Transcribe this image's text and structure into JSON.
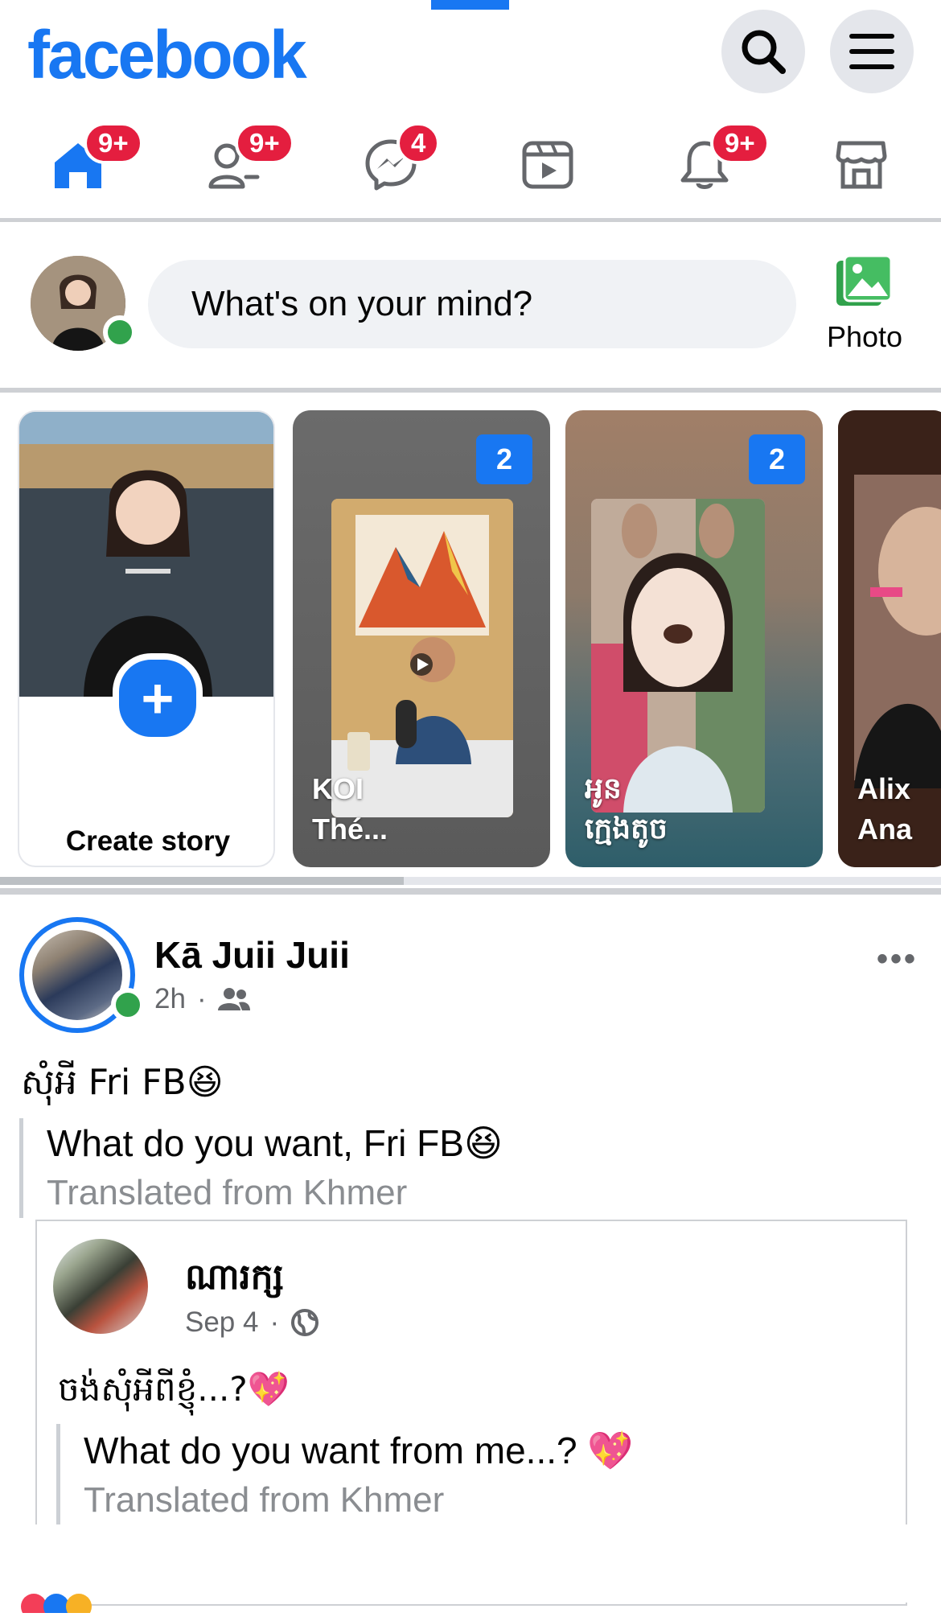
{
  "header": {
    "logo": "facebook",
    "search_icon": "search-icon",
    "menu_icon": "menu-icon"
  },
  "nav": [
    {
      "name": "home",
      "icon": "home-icon",
      "badge": "9+"
    },
    {
      "name": "friends",
      "icon": "friends-icon",
      "badge": "9+"
    },
    {
      "name": "messenger",
      "icon": "messenger-icon",
      "badge": "4"
    },
    {
      "name": "watch",
      "icon": "video-icon",
      "badge": ""
    },
    {
      "name": "notifications",
      "icon": "bell-icon",
      "badge": "9+"
    },
    {
      "name": "marketplace",
      "icon": "store-icon",
      "badge": ""
    }
  ],
  "composer": {
    "placeholder": "What's on your mind?",
    "photo_label": "Photo"
  },
  "stories": {
    "create_label": "Create story",
    "items": [
      {
        "name": "KOI Thé...",
        "name_line1": "KOI",
        "name_line2": "Thé...",
        "count": "2"
      },
      {
        "name": "អូន ក្មេងតូច",
        "name_line1": "អូន",
        "name_line2": "ក្មេងតូច",
        "count": "2"
      },
      {
        "name": "Alix Ana",
        "name_line1": "Alix",
        "name_line2": "Ana",
        "count": ""
      }
    ]
  },
  "post": {
    "author": "Kā Juii Juii",
    "time": "2h",
    "audience_icon": "friends-icon",
    "text": "សុំអី Fri FB😆",
    "translation": "What do you want, Fri FB😆",
    "translated_label": "Translated from Khmer",
    "shared": {
      "author": "ណារក្ស",
      "time": "Sep 4",
      "audience_icon": "globe-icon",
      "text": "ចង់សុំអីពីខ្ញុំ...?💖",
      "translation": "What do you want from me...? 💖",
      "translated_label": "Translated from Khmer"
    }
  },
  "colors": {
    "brand": "#1877f2",
    "badge": "#e41e3f",
    "online": "#31a24c"
  }
}
